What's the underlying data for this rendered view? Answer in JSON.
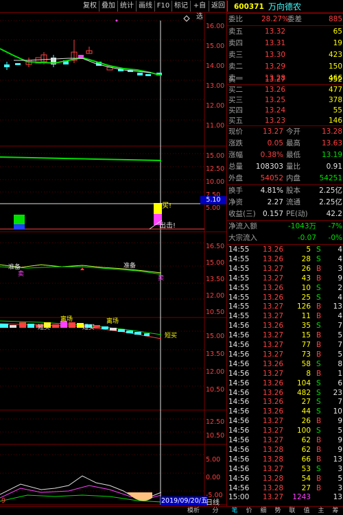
{
  "toolbar": {
    "items": [
      "复权",
      "叠加",
      "统计",
      "画线",
      "F10",
      "标记",
      "+自选",
      "返回"
    ]
  },
  "chart": {
    "main_axis": [
      "16.00",
      "15.00",
      "14.00",
      "13.00",
      "12.00",
      "11.00"
    ],
    "vol_axis": [
      "15.00",
      "12.50",
      "10.00",
      "7.50",
      "5.00"
    ],
    "vol_marker": "5.10",
    "ind1_axis": [
      "16.50",
      "15.00",
      "13.50",
      "12.00",
      "10.50"
    ],
    "ind2_axis": [
      "15.00",
      "13.50",
      "12.00",
      "10.50"
    ],
    "ind3_axis": [
      "12.50",
      "10.50"
    ],
    "ind4_axis": [
      "5.00",
      "0.00",
      "-5.00"
    ],
    "labels": {
      "buy_top": "买!",
      "attack": "出击!",
      "ready1": "准备",
      "ready2": "准备",
      "sell1": "卖",
      "sell2": "卖",
      "leave1": "离场",
      "leave2": "离场",
      "short_buy1": "短买",
      "short_buy2": "短买",
      "short_buy3": "短买"
    },
    "date_label": "2019/09/20/五",
    "period_label": "日线",
    "left_label": "9"
  },
  "quote": {
    "code": "600371",
    "name": "万向德农",
    "webi": {
      "label": "委比",
      "value": "28.27%",
      "label2": "委差",
      "value2": "885"
    },
    "asks": [
      {
        "label": "卖五",
        "price": "13.32",
        "vol": "65"
      },
      {
        "label": "卖四",
        "price": "13.31",
        "vol": "19"
      },
      {
        "label": "卖三",
        "price": "13.30",
        "vol": "423"
      },
      {
        "label": "卖二",
        "price": "13.29",
        "vol": "150"
      },
      {
        "label": "卖一",
        "price": "13.28",
        "vol": "466"
      }
    ],
    "bids": [
      {
        "label": "买一",
        "price": "13.27",
        "vol": "952"
      },
      {
        "label": "买二",
        "price": "13.26",
        "vol": "477"
      },
      {
        "label": "买三",
        "price": "13.25",
        "vol": "378"
      },
      {
        "label": "买四",
        "price": "13.24",
        "vol": "55"
      },
      {
        "label": "买五",
        "price": "13.23",
        "vol": "146"
      }
    ],
    "stats": [
      {
        "l1": "现价",
        "v1": "13.27",
        "c1": "red",
        "l2": "今开",
        "v2": "13.28",
        "c2": "red"
      },
      {
        "l1": "涨跌",
        "v1": "0.05",
        "c1": "red",
        "l2": "最高",
        "v2": "13.63",
        "c2": "red"
      },
      {
        "l1": "涨幅",
        "v1": "0.38%",
        "c1": "red",
        "l2": "最低",
        "v2": "13.19",
        "c2": "green"
      },
      {
        "l1": "总量",
        "v1": "108303",
        "c1": "white",
        "l2": "量比",
        "v2": "0.91",
        "c2": "white"
      },
      {
        "l1": "外盘",
        "v1": "54052",
        "c1": "red",
        "l2": "内盘",
        "v2": "54251",
        "c2": "green"
      }
    ],
    "stats2": [
      {
        "l1": "换手",
        "v1": "4.81%",
        "l2": "股本",
        "v2": "2.25亿"
      },
      {
        "l1": "净资",
        "v1": "2.27",
        "l2": "流通",
        "v2": "2.25亿"
      },
      {
        "l1": "收益(三)",
        "v1": "0.157",
        "l2": "PE(动)",
        "v2": "42.2"
      }
    ],
    "flows": [
      {
        "label": "净流入额",
        "value": "-1043万",
        "pct": "-7%"
      },
      {
        "label": "大宗流入",
        "value": "-0.07",
        "pct": "-0%"
      }
    ],
    "ticks": [
      {
        "t": "14:55",
        "p": "13.26",
        "v": "5",
        "d": "S",
        "n": "4"
      },
      {
        "t": "14:55",
        "p": "13.26",
        "v": "28",
        "d": "S",
        "n": "4"
      },
      {
        "t": "14:55",
        "p": "13.27",
        "v": "26",
        "d": "B",
        "n": "3"
      },
      {
        "t": "14:55",
        "p": "13.27",
        "v": "43",
        "d": "B",
        "n": "9"
      },
      {
        "t": "14:55",
        "p": "13.26",
        "v": "10",
        "d": "S",
        "n": "2"
      },
      {
        "t": "14:55",
        "p": "13.26",
        "v": "25",
        "d": "S",
        "n": "4"
      },
      {
        "t": "14:55",
        "p": "13.27",
        "v": "126",
        "d": "B",
        "n": "13"
      },
      {
        "t": "14:55",
        "p": "13.27",
        "v": "11",
        "d": "B",
        "n": "4"
      },
      {
        "t": "14:56",
        "p": "13.26",
        "v": "35",
        "d": "S",
        "n": "7"
      },
      {
        "t": "14:56",
        "p": "13.27",
        "v": "15",
        "d": "B",
        "n": "5"
      },
      {
        "t": "14:56",
        "p": "13.27",
        "v": "77",
        "d": "B",
        "n": "7"
      },
      {
        "t": "14:56",
        "p": "13.27",
        "v": "73",
        "d": "B",
        "n": "5"
      },
      {
        "t": "14:56",
        "p": "13.26",
        "v": "58",
        "d": "S",
        "n": "8"
      },
      {
        "t": "14:56",
        "p": "13.27",
        "v": "8",
        "d": "B",
        "n": "1"
      },
      {
        "t": "14:56",
        "p": "13.26",
        "v": "104",
        "d": "S",
        "n": "6"
      },
      {
        "t": "14:56",
        "p": "13.26",
        "v": "482",
        "d": "S",
        "n": "23"
      },
      {
        "t": "14:56",
        "p": "13.26",
        "v": "27",
        "d": "S",
        "n": "7"
      },
      {
        "t": "14:56",
        "p": "13.26",
        "v": "44",
        "d": "S",
        "n": "10"
      },
      {
        "t": "14:56",
        "p": "13.27",
        "v": "26",
        "d": "B",
        "n": "9"
      },
      {
        "t": "14:56",
        "p": "13.27",
        "v": "100",
        "d": "S",
        "n": "5"
      },
      {
        "t": "14:56",
        "p": "13.27",
        "v": "62",
        "d": "B",
        "n": "9"
      },
      {
        "t": "14:56",
        "p": "13.28",
        "v": "62",
        "d": "B",
        "n": "9"
      },
      {
        "t": "14:56",
        "p": "13.28",
        "v": "66",
        "d": "B",
        "n": "13"
      },
      {
        "t": "14:56",
        "p": "13.27",
        "v": "53",
        "d": "S",
        "n": "3"
      },
      {
        "t": "14:56",
        "p": "13.28",
        "v": "54",
        "d": "B",
        "n": "5"
      },
      {
        "t": "14:56",
        "p": "13.28",
        "v": "27",
        "d": "B",
        "n": "3"
      },
      {
        "t": "15:00",
        "p": "13.27",
        "v": "1243",
        "d": "",
        "n": "13"
      }
    ]
  },
  "bottom": {
    "tabs_left": [
      "模析",
      "分"
    ],
    "tabs_right": [
      "笔",
      "价",
      "细",
      "势",
      "联",
      "值",
      "主",
      "筹"
    ]
  },
  "colors": {
    "up": "#ff4040",
    "down": "#00e000",
    "grid": "#7a0000",
    "accent": "#00e0ff"
  }
}
